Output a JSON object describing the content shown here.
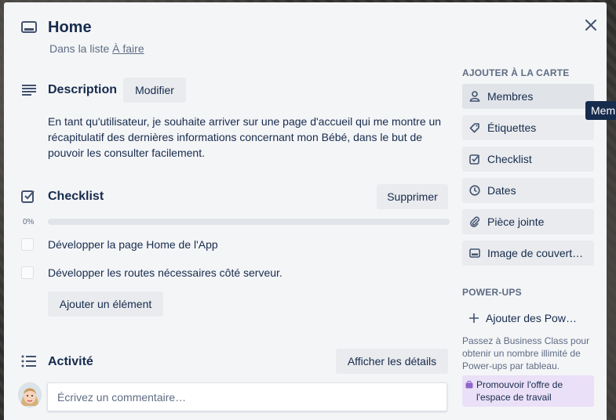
{
  "card": {
    "title": "Home",
    "list_prefix": "Dans la liste",
    "list_name": "À faire"
  },
  "description": {
    "heading": "Description",
    "edit_label": "Modifier",
    "text": "En tant qu'utilisateur, je souhaite arriver sur une page d'accueil qui me montre un récapitulatif des dernières informations concernant mon Bébé, dans le but de pouvoir les consulter facilement."
  },
  "checklist": {
    "heading": "Checklist",
    "delete_label": "Supprimer",
    "progress_label": "0%",
    "progress": 0,
    "items": [
      {
        "text": "Développer la page Home de l'App",
        "checked": false
      },
      {
        "text": "Développer les routes nécessaires côté serveur.",
        "checked": false
      }
    ],
    "add_label": "Ajouter un élément"
  },
  "activity": {
    "heading": "Activité",
    "details_label": "Afficher les détails",
    "comment_placeholder": "Écrivez un commentaire…"
  },
  "sidebar": {
    "add_heading": "AJOUTER À LA CARTE",
    "buttons": [
      {
        "label": "Membres",
        "icon": "person-icon"
      },
      {
        "label": "Étiquettes",
        "icon": "label-icon"
      },
      {
        "label": "Checklist",
        "icon": "checklist-icon"
      },
      {
        "label": "Dates",
        "icon": "clock-icon"
      },
      {
        "label": "Pièce jointe",
        "icon": "paperclip-icon"
      },
      {
        "label": "Image de couvert…",
        "icon": "cover-icon"
      }
    ],
    "powerups_heading": "POWER-UPS",
    "add_powerup_label": "Ajouter des Pow…",
    "powerups_note": "Passez à Business Class pour obtenir un nombre illimité de Power-ups par tableau.",
    "promo_label": "Promouvoir l'offre de l'espace de travail"
  },
  "tooltip": {
    "text": "Mem"
  },
  "colors": {
    "card_bg": "#f4f5f7",
    "button_bg": "#e9ebee",
    "text": "#172b4d",
    "muted": "#5e6c84",
    "promo_bg": "#eae0f7",
    "tooltip_bg": "#172b4d"
  }
}
